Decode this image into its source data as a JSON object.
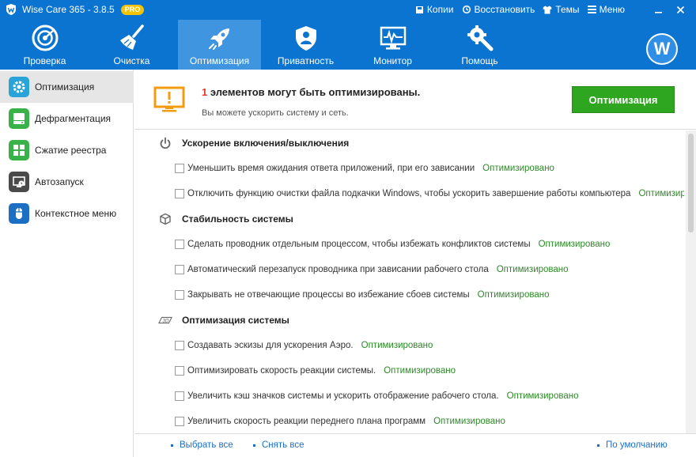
{
  "window": {
    "title": "Wise Care 365 - 3.8.5",
    "badge": "PRO",
    "actions": [
      {
        "label": "Копии",
        "icon": "backup-icon"
      },
      {
        "label": "Восстановить",
        "icon": "restore-icon"
      },
      {
        "label": "Темы",
        "icon": "shirt-icon"
      },
      {
        "label": "Меню",
        "icon": "menu-icon"
      }
    ]
  },
  "nav": {
    "items": [
      {
        "label": "Проверка",
        "icon": "radar-icon"
      },
      {
        "label": "Очистка",
        "icon": "broom-icon"
      },
      {
        "label": "Оптимизация",
        "icon": "rocket-icon",
        "active": true
      },
      {
        "label": "Приватность",
        "icon": "shield-icon"
      },
      {
        "label": "Монитор",
        "icon": "monitor-icon"
      },
      {
        "label": "Помощь",
        "icon": "tools-icon"
      }
    ],
    "avatar_letter": "W"
  },
  "sidebar": {
    "items": [
      {
        "label": "Оптимизация",
        "icon": "gear-icon",
        "active": true
      },
      {
        "label": "Дефрагментация",
        "icon": "disk-icon"
      },
      {
        "label": "Сжатие реестра",
        "icon": "registry-icon"
      },
      {
        "label": "Автозапуск",
        "icon": "startup-icon"
      },
      {
        "label": "Контекстное меню",
        "icon": "mouse-icon"
      }
    ]
  },
  "header": {
    "count": "1",
    "title_rest": " элементов могут быть оптимизированы.",
    "subtitle": "Вы можете ускорить систему и сеть.",
    "button": "Оптимизация"
  },
  "sections": [
    {
      "title": "Ускорение включения/выключения",
      "icon": "power-icon",
      "items": [
        {
          "text": "Уменьшить время ожидания ответа приложений, при его зависании",
          "status": "Оптимизировано"
        },
        {
          "text": "Отключить функцию очистки файла подкачки Windows, чтобы ускорить завершение работы компьютера",
          "status": "Оптимизиро..."
        }
      ]
    },
    {
      "title": "Стабильность системы",
      "icon": "cube-icon",
      "items": [
        {
          "text": "Сделать проводник отдельным процессом, чтобы избежать конфликтов системы",
          "status": "Оптимизировано"
        },
        {
          "text": "Автоматический перезапуск проводника при зависании рабочего стола",
          "status": "Оптимизировано"
        },
        {
          "text": "Закрывать не отвечающие процессы во избежание сбоев системы",
          "status": "Оптимизировано"
        }
      ]
    },
    {
      "title": "Оптимизация системы",
      "icon": "3d-icon",
      "items": [
        {
          "text": "Создавать эскизы для ускорения Аэро.",
          "status": "Оптимизировано"
        },
        {
          "text": "Оптимизировать скорость реакции системы.",
          "status": "Оптимизировано"
        },
        {
          "text": "Увеличить кэш значков системы и ускорить отображение рабочего стола.",
          "status": "Оптимизировано"
        },
        {
          "text": "Увеличить скорость реакции переднего плана программ",
          "status": "Оптимизировано"
        }
      ]
    }
  ],
  "footer": {
    "select_all": "Выбрать все",
    "deselect_all": "Снять все",
    "default": "По умолчанию"
  },
  "colors": {
    "brand_blue": "#0a74d0",
    "nav_active": "#3f95e0",
    "optimize_green": "#2fa61f",
    "status_green": "#2c8a26",
    "warning_orange": "#f39c12",
    "link_blue": "#1d6fc4"
  }
}
